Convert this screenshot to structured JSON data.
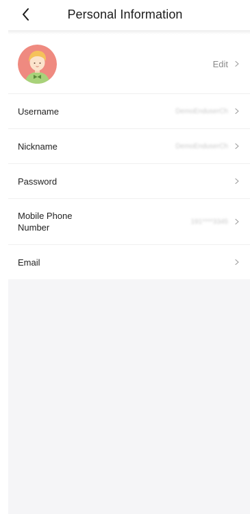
{
  "header": {
    "title": "Personal Information"
  },
  "profile": {
    "edit_label": "Edit",
    "avatar_icon": "avatar-image"
  },
  "rows": [
    {
      "label": "Username",
      "value": "DemoEnduserCh"
    },
    {
      "label": "Nickname",
      "value": "DemoEnduserCh"
    },
    {
      "label": "Password",
      "value": ""
    },
    {
      "label": "Mobile Phone Number",
      "value": "191****3345"
    },
    {
      "label": "Email",
      "value": ""
    }
  ],
  "colors": {
    "avatar_bg": "#ef8a80",
    "background": "#f5f5f7",
    "text": "#222222",
    "muted": "#8a8a8a"
  }
}
